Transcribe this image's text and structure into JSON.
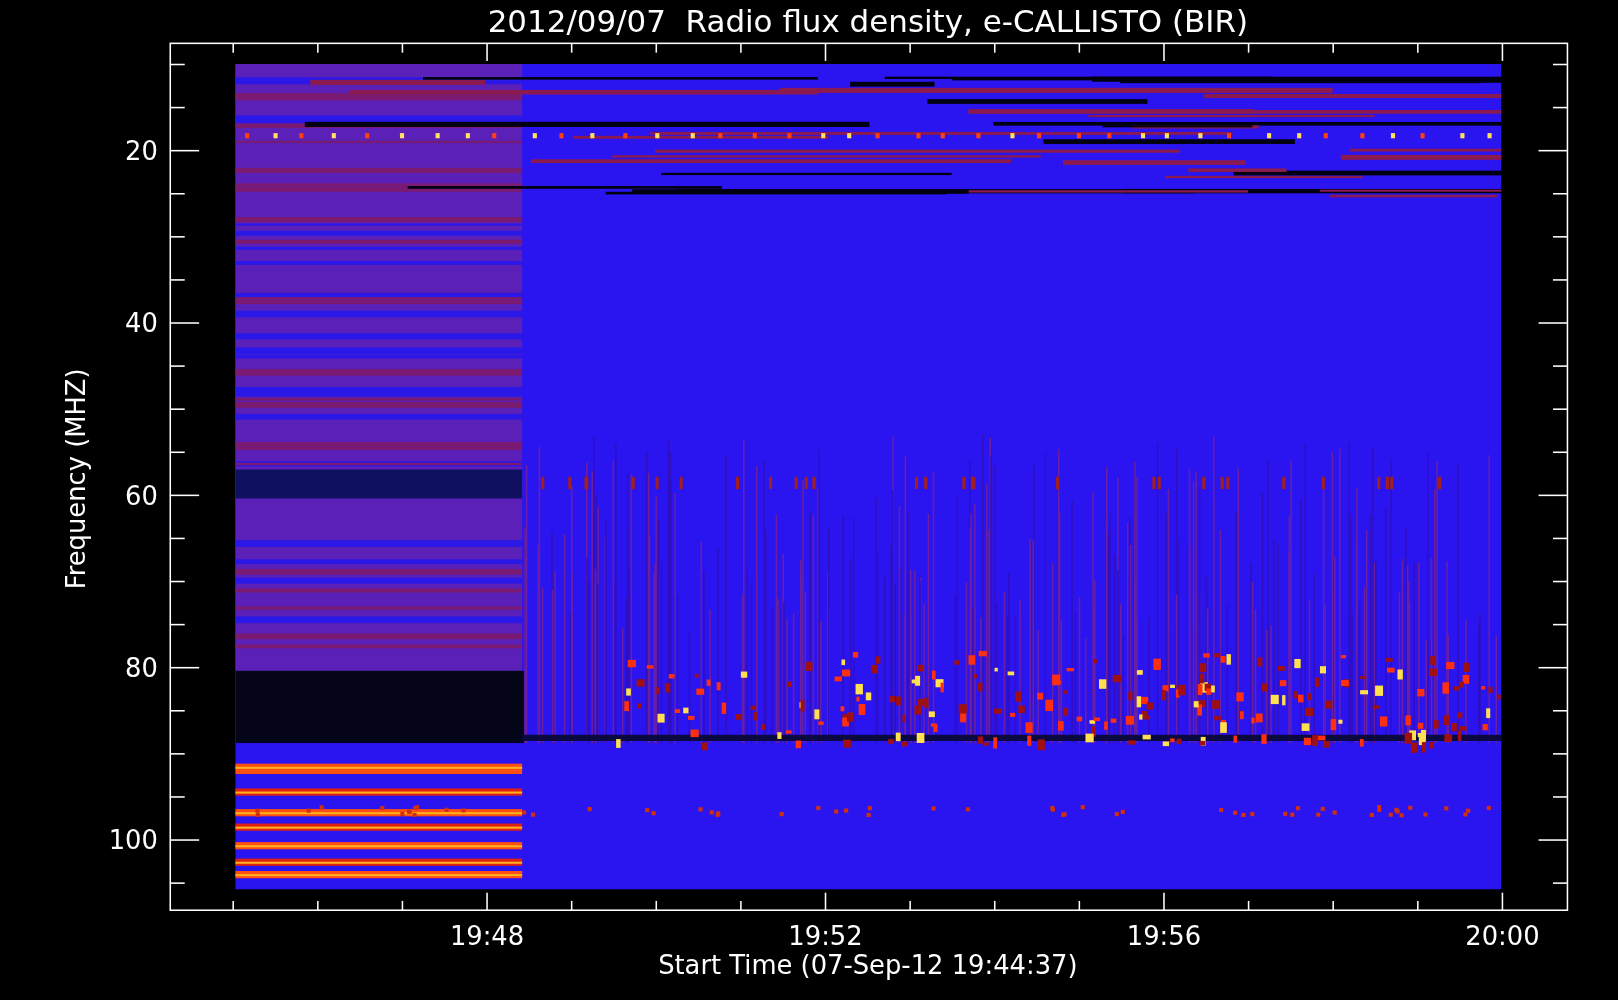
{
  "chart": {
    "title": "2012/09/07  Radio flux density, e-CALLISTO (BIR)",
    "y_axis": {
      "label": "Frequency (MHZ)",
      "ticks": [
        "20",
        "40",
        "60",
        "80",
        "100"
      ]
    },
    "x_axis": {
      "label": "Start Time (07-Sep-12 19:44:37)",
      "ticks": [
        "19:48",
        "19:52",
        "19:56",
        "20:00"
      ]
    }
  }
}
